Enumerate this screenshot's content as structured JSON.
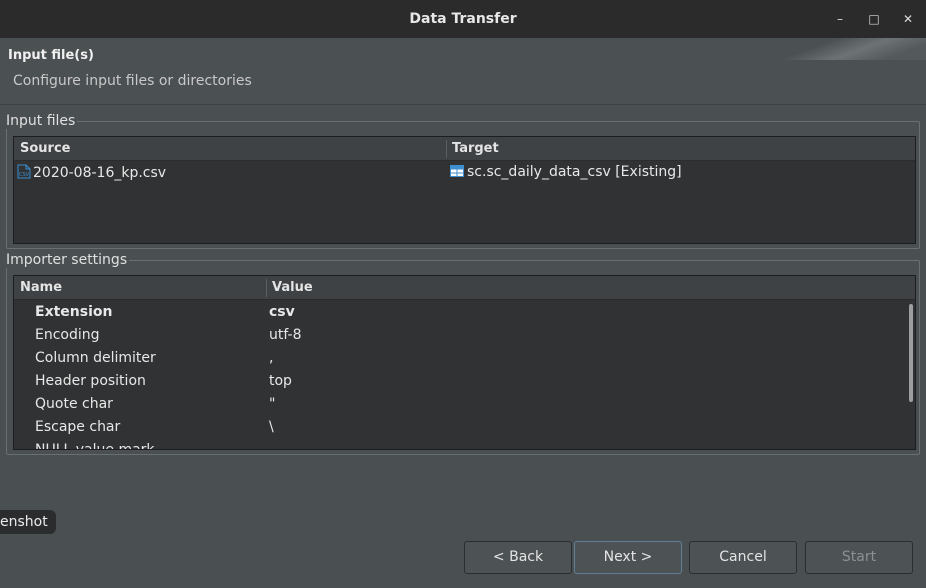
{
  "window": {
    "title": "Data Transfer"
  },
  "header": {
    "title": "Input file(s)",
    "description": "Configure input files or directories"
  },
  "input_files": {
    "legend": "Input files",
    "columns": [
      "Source",
      "Target"
    ],
    "rows": [
      {
        "source": "2020-08-16_kp.csv",
        "source_icon": "csv-file-icon",
        "target": "sc.sc_daily_data_csv [Existing]",
        "target_icon": "table-icon"
      }
    ]
  },
  "importer_settings": {
    "legend": "Importer settings",
    "columns": [
      "Name",
      "Value"
    ],
    "rows": [
      {
        "name": "Extension",
        "value": "csv"
      },
      {
        "name": "Encoding",
        "value": "utf-8"
      },
      {
        "name": "Column delimiter",
        "value": ","
      },
      {
        "name": "Header position",
        "value": "top"
      },
      {
        "name": "Quote char",
        "value": "\""
      },
      {
        "name": "Escape char",
        "value": "\\"
      },
      {
        "name": "NULL value mark",
        "value": ""
      }
    ]
  },
  "tooltip": {
    "text": "enshot"
  },
  "buttons": {
    "back": "< Back",
    "next": "Next >",
    "cancel": "Cancel",
    "start": "Start"
  },
  "colors": {
    "accent": "#5f7f98",
    "icon_blue": "#3d8fd1"
  }
}
